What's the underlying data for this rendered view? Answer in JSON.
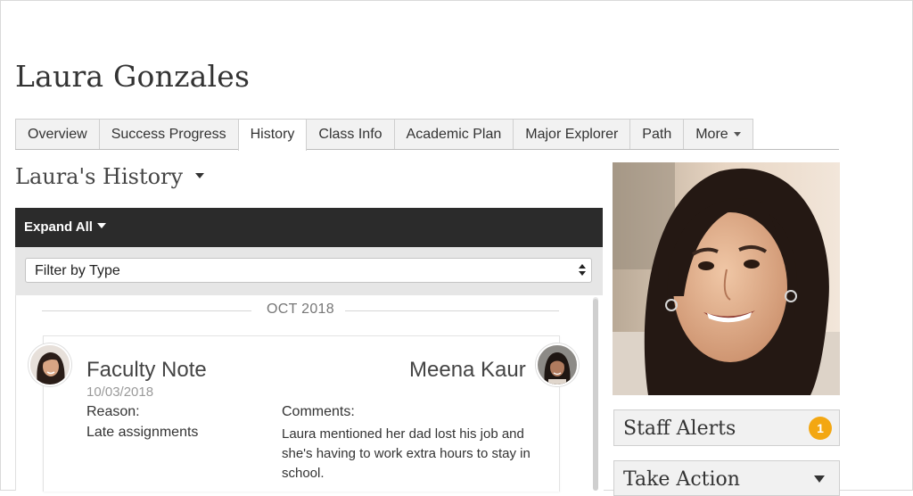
{
  "student": {
    "name": "Laura Gonzales"
  },
  "tabs": [
    {
      "label": "Overview"
    },
    {
      "label": "Success Progress"
    },
    {
      "label": "History",
      "active": true
    },
    {
      "label": "Class Info"
    },
    {
      "label": "Academic Plan"
    },
    {
      "label": "Major Explorer"
    },
    {
      "label": "Path"
    },
    {
      "label": "More"
    }
  ],
  "history": {
    "heading": "Laura's History",
    "expand_all_label": "Expand All",
    "filter_value": "Filter by Type",
    "month_label": "OCT 2018",
    "note": {
      "type": "Faculty Note",
      "author": "Meena Kaur",
      "date": "10/03/2018",
      "reason_label": "Reason:",
      "reason_value": "Late assignments",
      "comments_label": "Comments:",
      "comments_value": "Laura mentioned her dad lost his job and she's having to work extra hours to stay in school."
    }
  },
  "sidebar": {
    "staff_alerts_label": "Staff Alerts",
    "staff_alerts_count": "1",
    "take_action_label": "Take Action"
  },
  "colors": {
    "toolbar_bg": "#2b2b2b",
    "badge": "#f3a712",
    "panel_bg": "#f1f1f1"
  },
  "icons": [
    "caret-down-icon",
    "select-arrows-icon"
  ]
}
